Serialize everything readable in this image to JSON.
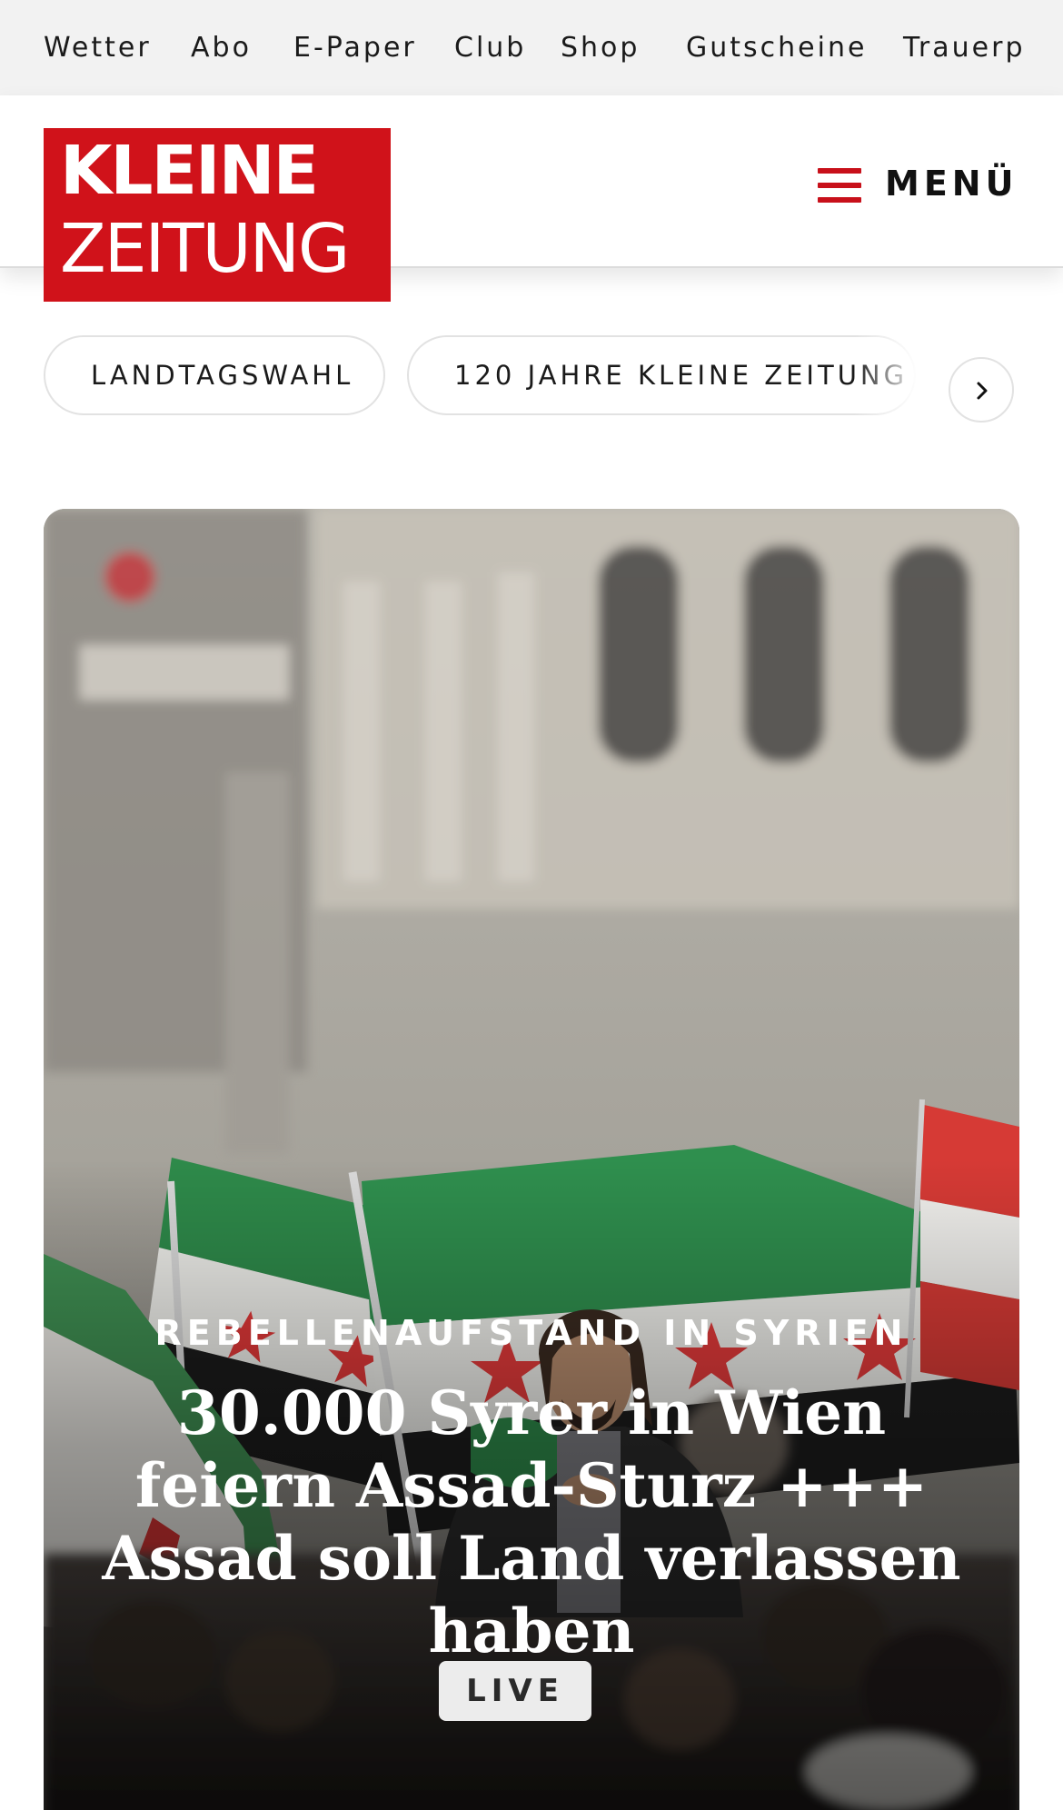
{
  "topbar": {
    "items": [
      "Wetter",
      "Abo",
      "E-Paper",
      "Club",
      "Shop",
      "Gutscheine",
      "Trauerp"
    ]
  },
  "header": {
    "logo": {
      "line1": "KLEINE",
      "line2": "ZEITUNG",
      "color": "#d0121a"
    },
    "menu_label": "MENÜ",
    "menu_icon": "hamburger-icon",
    "accent": "#c8101a"
  },
  "topics": {
    "chips": [
      "LANDTAGSWAHL",
      "120 JAHRE KLEINE ZEITUNG"
    ],
    "next_icon": "chevron-right-icon"
  },
  "hero": {
    "kicker": "REBELLENAUFSTAND IN SYRIEN",
    "title": "30.000 Syrer in Wien feiern Assad-Sturz +++ Assad soll Land verlassen haben",
    "badge": "LIVE"
  }
}
